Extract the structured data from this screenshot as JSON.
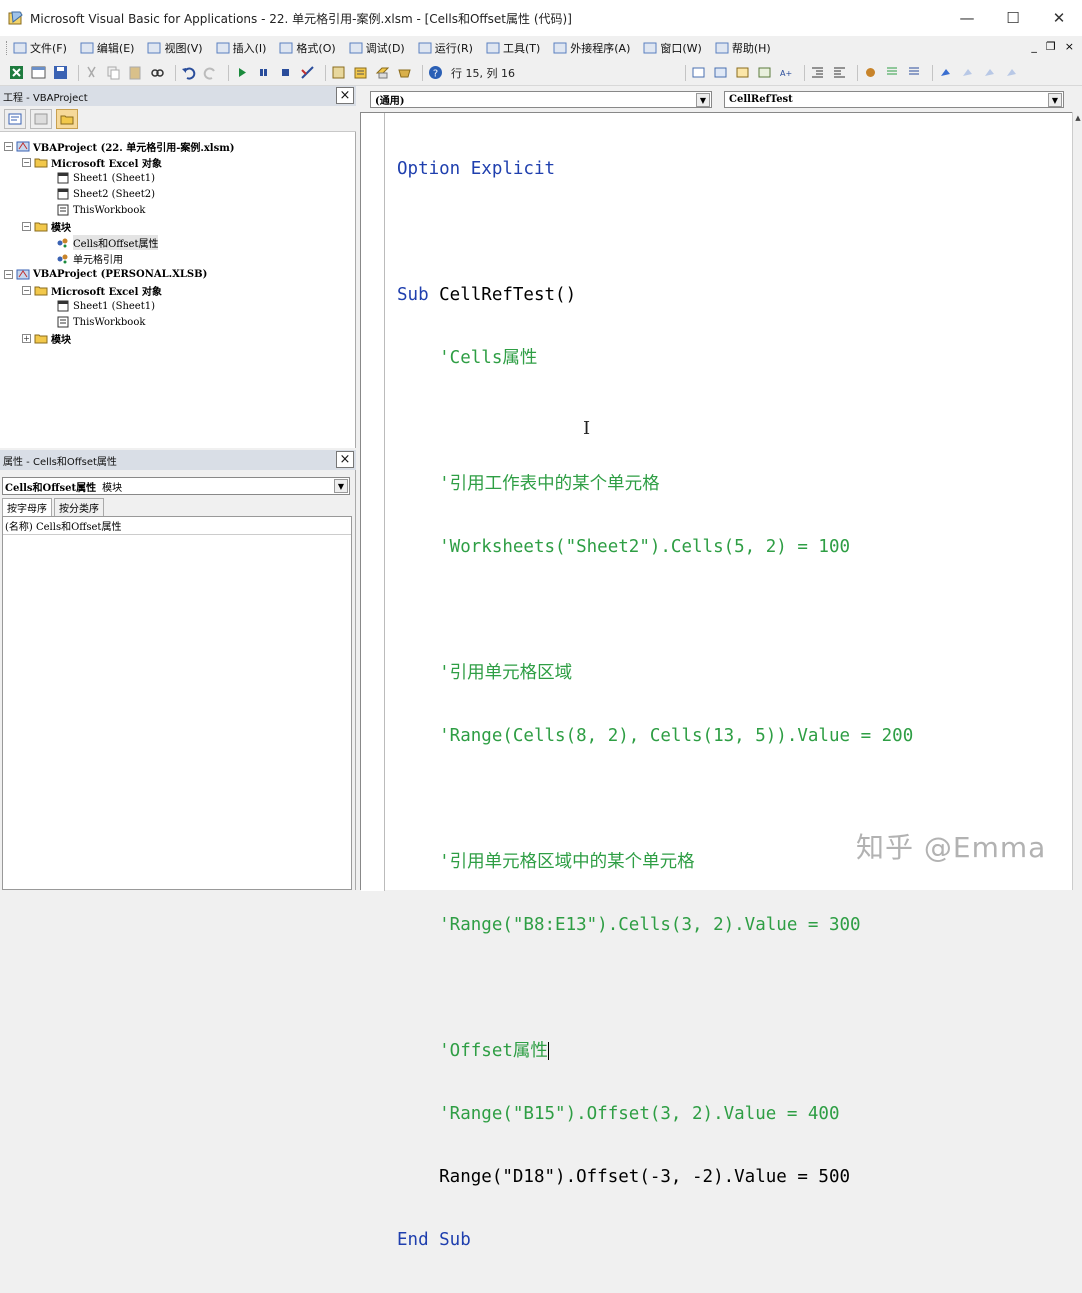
{
  "window": {
    "title": "Microsoft Visual Basic for Applications - 22. 单元格引用-案例.xlsm - [Cells和Offset属性 (代码)]",
    "minimize": "—",
    "maximize": "☐",
    "close": "✕"
  },
  "menu": {
    "items": [
      {
        "label": "文件(F)",
        "icon": "file-icon"
      },
      {
        "label": "编辑(E)",
        "icon": "edit-icon"
      },
      {
        "label": "视图(V)",
        "icon": "view-icon"
      },
      {
        "label": "插入(I)",
        "icon": "insert-icon"
      },
      {
        "label": "格式(O)",
        "icon": "format-icon"
      },
      {
        "label": "调试(D)",
        "icon": "debug-icon"
      },
      {
        "label": "运行(R)",
        "icon": "run-icon"
      },
      {
        "label": "工具(T)",
        "icon": "tools-icon"
      },
      {
        "label": "外接程序(A)",
        "icon": "addins-icon"
      },
      {
        "label": "窗口(W)",
        "icon": "window-icon"
      },
      {
        "label": "帮助(H)",
        "icon": "help-icon"
      }
    ],
    "mdi_minimize": "_",
    "mdi_restore": "❐",
    "mdi_close": "×"
  },
  "toolbar": {
    "cursor_position": "行 15, 列 16"
  },
  "project_explorer": {
    "title": "工程 - VBAProject",
    "close": "×",
    "tree": [
      {
        "label": "VBAProject (22. 单元格引用-案例.xlsm)",
        "bold": true,
        "icon": "vbaproject-icon"
      },
      {
        "label": "Microsoft Excel 对象",
        "bold": true,
        "icon": "folder-icon"
      },
      {
        "label": "Sheet1 (Sheet1)",
        "bold": false,
        "icon": "sheet-icon"
      },
      {
        "label": "Sheet2 (Sheet2)",
        "bold": false,
        "icon": "sheet-icon"
      },
      {
        "label": "ThisWorkbook",
        "bold": false,
        "icon": "workbook-icon"
      },
      {
        "label": "模块",
        "bold": true,
        "icon": "folder-icon"
      },
      {
        "label": "Cells和Offset属性",
        "bold": false,
        "icon": "module-icon"
      },
      {
        "label": "单元格引用",
        "bold": false,
        "icon": "module-icon"
      },
      {
        "label": "VBAProject (PERSONAL.XLSB)",
        "bold": true,
        "icon": "vbaproject-icon"
      },
      {
        "label": "Microsoft Excel 对象",
        "bold": true,
        "icon": "folder-icon"
      },
      {
        "label": "Sheet1 (Sheet1)",
        "bold": false,
        "icon": "sheet-icon"
      },
      {
        "label": "ThisWorkbook",
        "bold": false,
        "icon": "workbook-icon"
      },
      {
        "label": "模块",
        "bold": true,
        "icon": "folder-icon"
      }
    ]
  },
  "properties": {
    "title": "属性 - Cells和Offset属性",
    "close": "×",
    "object_name": "Cells和Offset属性",
    "object_type": "模块",
    "tabs": [
      "按字母序",
      "按分类序"
    ],
    "rows": [
      "(名称) Cells和Offset属性"
    ]
  },
  "code": {
    "object_combo": "(通用)",
    "procedure_combo": "CellRefTest",
    "lines": {
      "l1_kw": "Option Explicit",
      "l2_kw": "Sub",
      "l2_rest": " CellRefTest()",
      "l3": "    'Cells属性",
      "l4": "    '引用工作表中的某个单元格",
      "l5": "    'Worksheets(\"Sheet2\").Cells(5, 2) = 100",
      "l6": "    '引用单元格区域",
      "l7": "    'Range(Cells(8, 2), Cells(13, 5)).Value = 200",
      "l8": "    '引用单元格区域中的某个单元格",
      "l9": "    'Range(\"B8:E13\").Cells(3, 2).Value = 300",
      "l10": "    'Offset属性",
      "l11": "    'Range(\"B15\").Offset(3, 2).Value = 400",
      "l12": "    Range(\"D18\").Offset(-3, -2).Value = 500",
      "l13_kw": "End Sub"
    },
    "colors": {
      "keyword": "#1f3fae",
      "comment": "#2e9e44",
      "text": "#000000"
    }
  },
  "watermark": "知乎 @Emma"
}
